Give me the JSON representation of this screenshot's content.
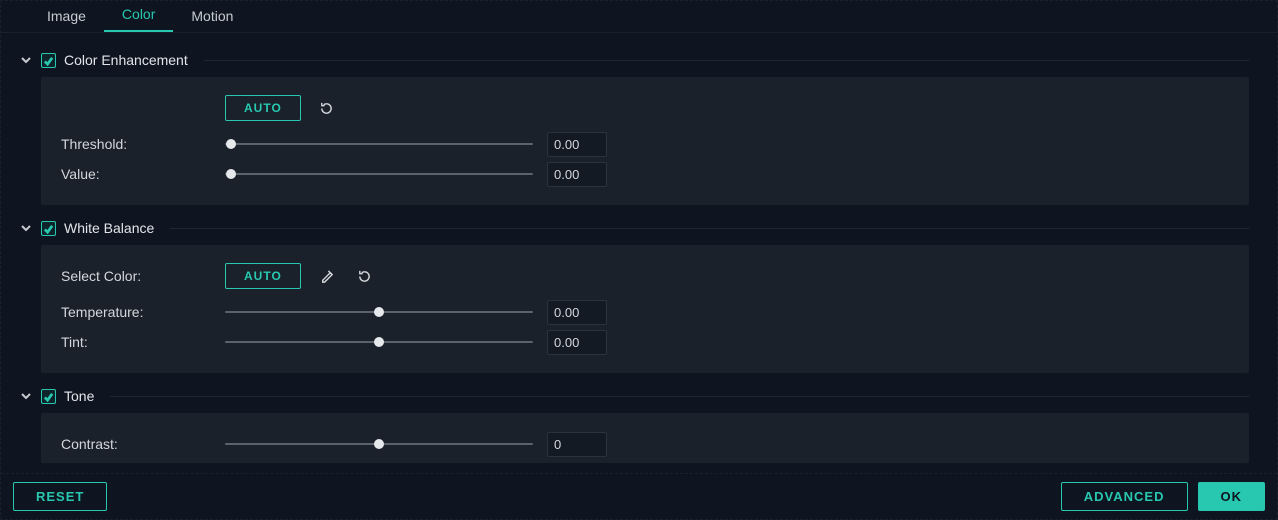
{
  "tabs": [
    {
      "label": "Image",
      "active": false
    },
    {
      "label": "Color",
      "active": true
    },
    {
      "label": "Motion",
      "active": false
    }
  ],
  "sections": {
    "color_enhancement": {
      "title": "Color Enhancement",
      "checked": true,
      "auto_label": "AUTO",
      "rows": {
        "threshold": {
          "label": "Threshold:",
          "value": "0.00",
          "pos": 0.02
        },
        "value": {
          "label": "Value:",
          "value": "0.00",
          "pos": 0.02
        }
      }
    },
    "white_balance": {
      "title": "White Balance",
      "checked": true,
      "select_color_label": "Select Color:",
      "auto_label": "AUTO",
      "rows": {
        "temperature": {
          "label": "Temperature:",
          "value": "0.00",
          "pos": 0.5
        },
        "tint": {
          "label": "Tint:",
          "value": "0.00",
          "pos": 0.5
        }
      }
    },
    "tone": {
      "title": "Tone",
      "checked": true,
      "rows": {
        "contrast": {
          "label": "Contrast:",
          "value": "0",
          "pos": 0.5
        }
      }
    }
  },
  "footer": {
    "reset": "RESET",
    "advanced": "ADVANCED",
    "ok": "OK"
  },
  "colors": {
    "accent": "#28c8b0",
    "bg": "#0e1520",
    "panel": "#1a212b"
  }
}
